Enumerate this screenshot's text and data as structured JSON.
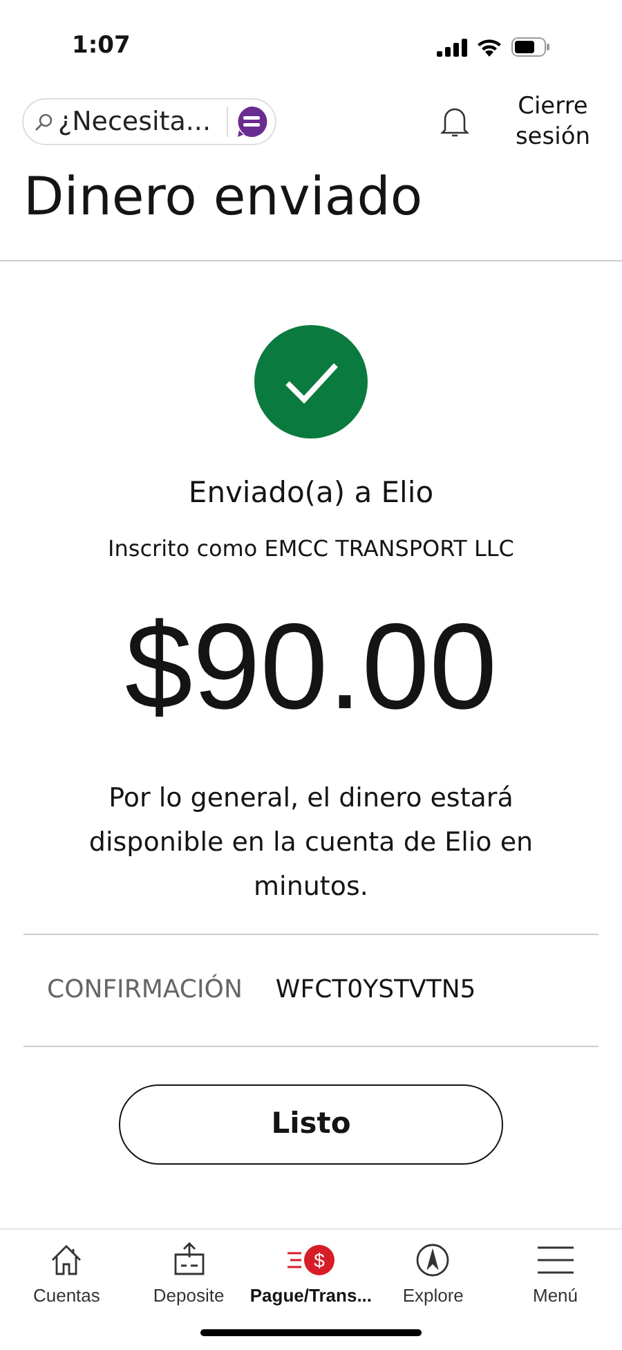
{
  "status_bar": {
    "time": "1:07"
  },
  "header": {
    "search": {
      "placeholder": "¿Necesita..."
    },
    "logout": "Cierre sesión"
  },
  "title": "Dinero enviado",
  "result": {
    "recipient": "Enviado(a) a Elio",
    "enrolled": "Inscrito como EMCC TRANSPORT LLC",
    "amount": "$90.00",
    "message": "Por lo general, el dinero estará disponible en la cuenta de Elio en minutos."
  },
  "confirmation": {
    "label": "CONFIRMACIÓN",
    "value": "WFCT0YSTVTN5"
  },
  "done_button": "Listo",
  "nav": [
    {
      "label": "Cuentas",
      "kind": "home",
      "selected": false
    },
    {
      "label": "Deposite",
      "kind": "deposit",
      "selected": false
    },
    {
      "label": "Pague/Trans...",
      "kind": "pay",
      "symbol": "$",
      "selected": true
    },
    {
      "label": "Explore",
      "kind": "compass",
      "selected": false
    },
    {
      "label": "Menú",
      "kind": "menu",
      "selected": false
    }
  ]
}
